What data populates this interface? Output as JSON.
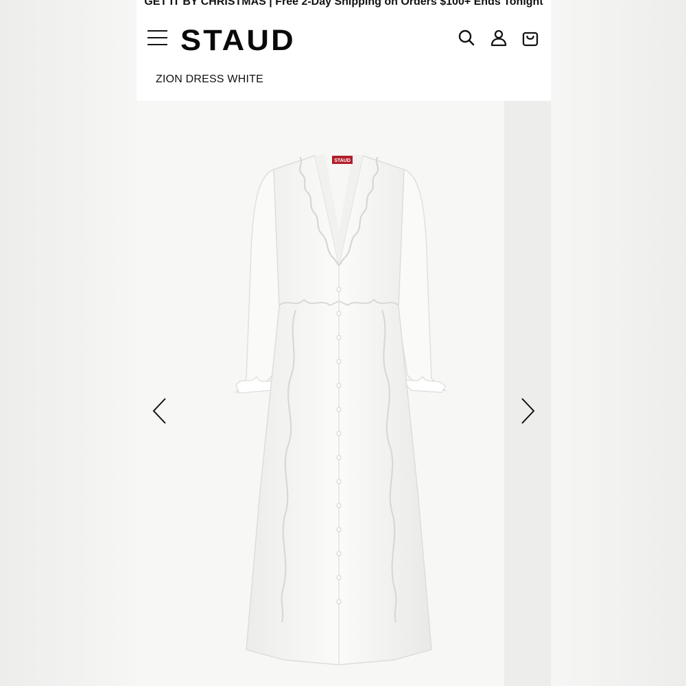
{
  "promo_banner": {
    "text": "GET IT BY CHRISTMAS | Free 2-Day Shipping on Orders $100+ Ends Tonight"
  },
  "header": {
    "logo": "STAUD",
    "icons": [
      "menu-icon",
      "search-icon",
      "account-icon",
      "bag-icon"
    ]
  },
  "product": {
    "title": "ZION DRESS WHITE",
    "image": "white-ruffle-midi-dress",
    "label_tag": "STAUD"
  },
  "gallery": {
    "prev_icon": "chevron-left-icon",
    "next_icon": "chevron-right-icon"
  },
  "colors": {
    "tag_red": "#b11f2b",
    "text": "#111111",
    "background": "#f2f2f1"
  }
}
